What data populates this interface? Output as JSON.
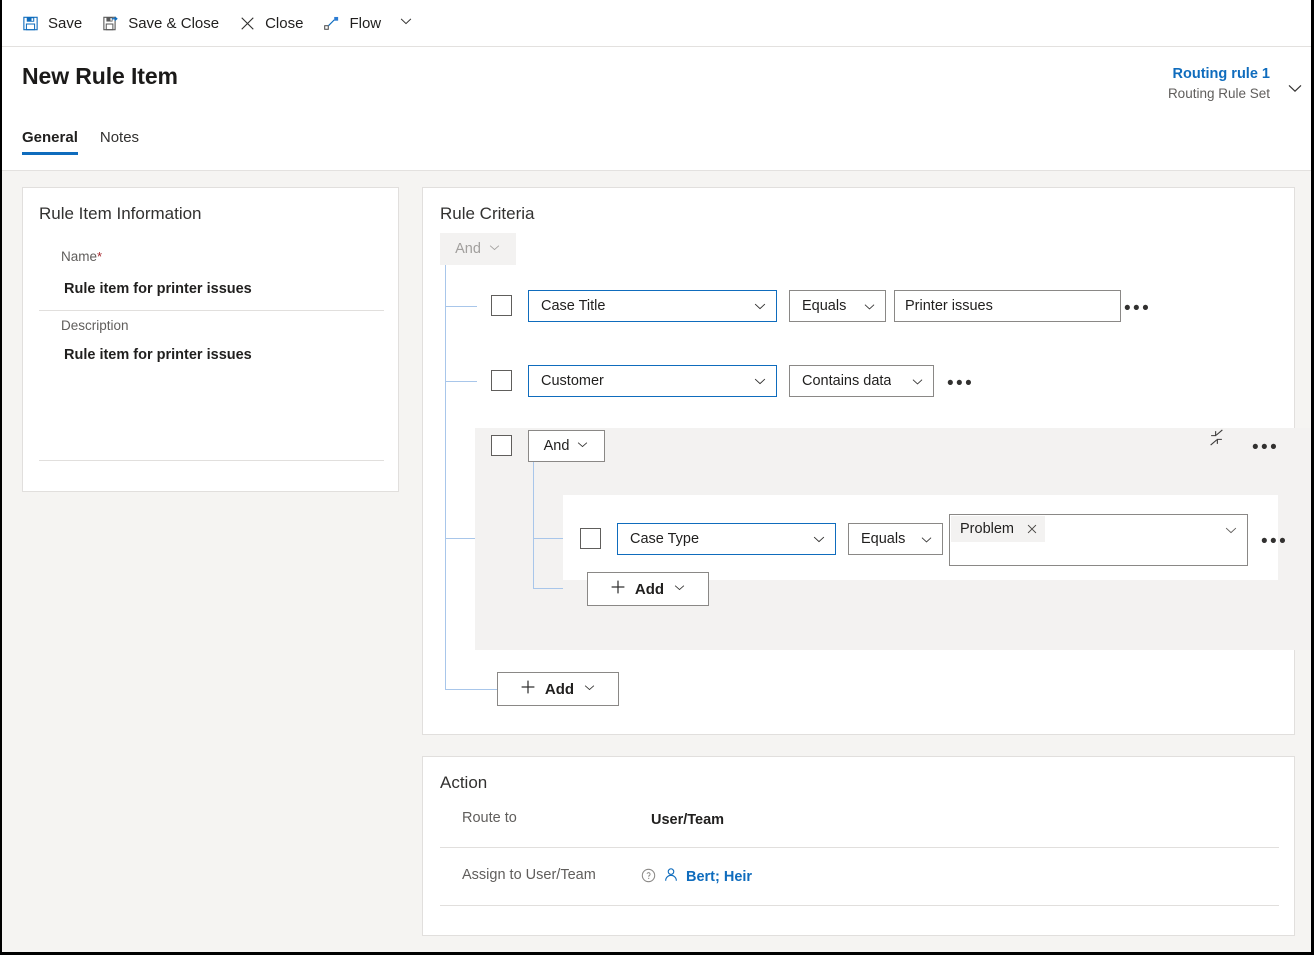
{
  "commandbar": {
    "items": [
      {
        "id": "save",
        "label": "Save",
        "icon": "save-icon"
      },
      {
        "id": "save-close",
        "label": "Save & Close",
        "icon": "save-and-close-icon"
      },
      {
        "id": "close",
        "label": "Close",
        "icon": "close-x-icon"
      },
      {
        "id": "flow",
        "label": "Flow",
        "icon": "flow-icon"
      }
    ],
    "overflow_chevron": "chevron-down-icon"
  },
  "header": {
    "title": "New Rule Item",
    "context": {
      "primary": "Routing rule 1",
      "secondary": "Routing Rule Set"
    },
    "tabs": [
      {
        "id": "general",
        "label": "General",
        "active": true
      },
      {
        "id": "notes",
        "label": "Notes",
        "active": false
      }
    ]
  },
  "rule_item_information": {
    "heading": "Rule Item Information",
    "fields": [
      {
        "id": "name",
        "label": "Name",
        "required": true,
        "required_marker": "*",
        "value": "Rule item for printer issues"
      },
      {
        "id": "description",
        "label": "Description",
        "required": false,
        "value": "Rule item for printer issues"
      }
    ]
  },
  "rule_criteria": {
    "heading": "Rule Criteria",
    "root_operator": {
      "label": "And",
      "disabled": true
    },
    "rows": [
      {
        "id": "row-case-title",
        "field": "Case Title",
        "operator": "Equals",
        "value": "Printer issues",
        "value_type": "text",
        "more_label": "•••"
      },
      {
        "id": "row-customer",
        "field": "Customer",
        "operator": "Contains data",
        "value": "",
        "value_type": "none",
        "more_label": "•••"
      }
    ],
    "nested_group": {
      "operator": "And",
      "collapse_icon": "collapse-arrows-icon",
      "more_label": "•••",
      "rows": [
        {
          "id": "row-case-type",
          "field": "Case Type",
          "operator": "Equals",
          "value_tags": [
            {
              "label": "Problem",
              "remove_icon": "close-x-icon"
            }
          ],
          "value_type": "multiselect",
          "more_label": "•••"
        }
      ],
      "add_button": {
        "label": "Add",
        "plus_icon": "plus-icon",
        "chevron": "chevron-down-icon"
      }
    },
    "add_button": {
      "label": "Add",
      "plus_icon": "plus-icon",
      "chevron": "chevron-down-icon"
    }
  },
  "action": {
    "heading": "Action",
    "rows": [
      {
        "id": "route-to",
        "label": "Route to",
        "value": "User/Team",
        "type": "text"
      },
      {
        "id": "assign-to",
        "label": "Assign to User/Team",
        "value": "Bert; Heir",
        "type": "lookup",
        "info_icon": "info-circle-icon",
        "person_icon": "person-icon"
      }
    ]
  },
  "colors": {
    "accent": "#0f6cbd",
    "required": "#a4262c",
    "connector": "#a8c6ea",
    "panel_bg": "#f5f4f2",
    "group_bg": "#f3f2f1",
    "border": "#8a8886"
  }
}
